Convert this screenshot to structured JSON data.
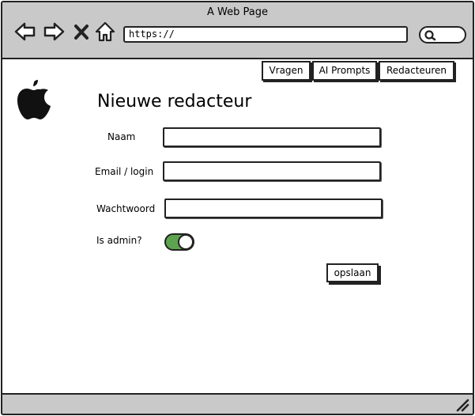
{
  "window": {
    "title": "A Web Page"
  },
  "browser": {
    "url": "https://",
    "icons": [
      "back-arrow-icon",
      "forward-arrow-icon",
      "close-x-icon",
      "home-icon",
      "search-icon"
    ]
  },
  "nav": {
    "tabs": [
      {
        "label": "Vragen"
      },
      {
        "label": "AI Prompts"
      },
      {
        "label": "Redacteuren"
      }
    ]
  },
  "page": {
    "logo_icon": "apple-logo-icon",
    "title": "Nieuwe redacteur"
  },
  "form": {
    "name_label": "Naam",
    "name_value": "",
    "email_label": "Email / login",
    "email_value": "",
    "password_label": "Wachtwoord",
    "password_value": "",
    "admin_label": "Is admin?",
    "admin_enabled": true,
    "toggle_color": "#5ea34f",
    "save_label": "opslaan"
  }
}
